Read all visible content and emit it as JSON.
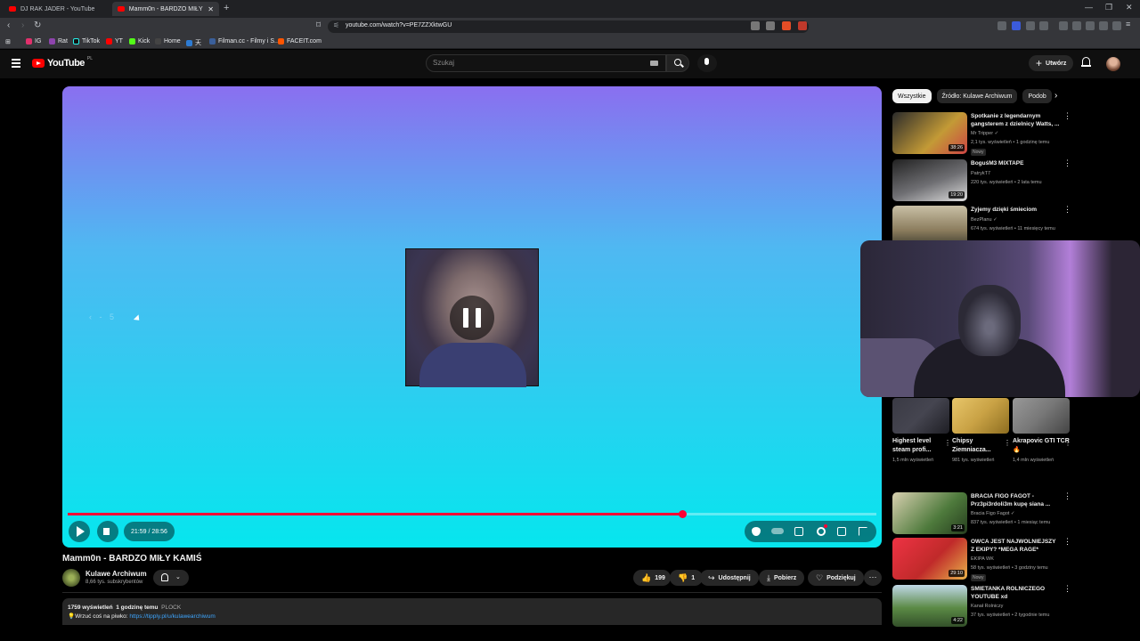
{
  "browser": {
    "tabs": [
      {
        "title": "DJ RAK JADER - YouTube",
        "active": false
      },
      {
        "title": "Mamm0n - BARDZO MIŁY KAMIŚ",
        "active": true
      }
    ],
    "url": "youtube.com/watch?v=PE7ZZXktwGU",
    "bookmarks": [
      {
        "label": "IG",
        "color": "#e1306c"
      },
      {
        "label": "Rat",
        "color": "#8e44ad"
      },
      {
        "label": "TikTok",
        "color": "#111111"
      },
      {
        "label": "YT",
        "color": "#ff0000"
      },
      {
        "label": "Kick",
        "color": "#53fc18"
      },
      {
        "label": "Home",
        "color": "#444444"
      },
      {
        "label": "天",
        "color": "#2d7bd3"
      },
      {
        "label": "Filman.cc - Filmy i S...",
        "color": "#3a5f9a"
      },
      {
        "label": "FACEIT.com",
        "color": "#ff5500"
      }
    ]
  },
  "youtube": {
    "logo": "YouTube",
    "region": "PL",
    "search_placeholder": "Szukaj",
    "create_label": "Utwórz"
  },
  "player": {
    "current_time": "21:59",
    "duration": "28:56",
    "time_display": "21:59 / 28:56",
    "progress_fraction": 0.76,
    "state": "paused",
    "seek_hint": "‹ - 5"
  },
  "video": {
    "title": "Mamm0n - BARDZO MIŁY KAMIŚ",
    "channel": "Kulawe Archiwum",
    "subscribers": "8,66 tys. subskrybentów",
    "likes": "199",
    "dislikes": "1",
    "share_label": "Udostępnij",
    "download_label": "Pobierz",
    "thanks_label": "Podziękuj",
    "views": "1759 wyświetleń",
    "posted": "1 godzinę temu",
    "location": "PLOCK",
    "desc_text": "💡Wrzuć coś na piwko: ",
    "desc_link": "https://tipply.pl/u/kulawearchiwum"
  },
  "sidebar": {
    "chips": [
      "Wszystkie",
      "Źródło: Kulawe Archiwum",
      "Podob"
    ],
    "top_recs": [
      {
        "title": "Spotkanie z legendarnym gangsterem z dzielnicy Watts, ...",
        "channel": "Mr Tripper ✓",
        "stats": "2,1 tys. wyświetleń • 1 godzinę temu",
        "badge": "Nowy",
        "duration": "38:26",
        "thumb": "#c39a36"
      },
      {
        "title": "BoguśM3 MIXTAPE",
        "channel": "PatrykT7",
        "stats": "220 tys. wyświetleń • 2 lata temu",
        "badge": "",
        "duration": "19:20",
        "thumb": "#6f6f73"
      },
      {
        "title": "Żyjemy dzięki śmieciom",
        "channel": "BezPlanu ✓",
        "stats": "674 tys. wyświetleń • 11 miesięcy temu",
        "badge": "",
        "duration": "",
        "thumb": "#8a7b5c"
      }
    ],
    "shorts": [
      {
        "title": "Highest level steam profi...",
        "views": "1,5 mln wyświetleń",
        "thumb": "#454550"
      },
      {
        "title": "Chipsy Ziemniacza...",
        "views": "981 tys. wyświetleń",
        "thumb": "#c9a245"
      },
      {
        "title": "Akrapovic GTI TCR 🔥",
        "views": "1,4 mln wyświetleń",
        "thumb": "#777777"
      }
    ],
    "bottom_recs": [
      {
        "title": "BRACIA FIGO FAGOT - Prz3pi3rdoli3m kupę siana ...",
        "channel": "Bracia Figo Fagot ✓",
        "stats": "837 tys. wyświetleń • 1 miesiąc temu",
        "badge": "",
        "duration": "3:21",
        "thumb": "#4e7a3c"
      },
      {
        "title": "OWCA JEST NAJWOLNIEJSZY Z EKIPY? *MEGA RAGE*",
        "channel": "EKIPA WK",
        "stats": "58 tys. wyświetleń • 3 godziny temu",
        "badge": "Nowy",
        "duration": "29:10",
        "thumb": "#c02a2a"
      },
      {
        "title": "ŚMIETANKA ROLNICZEGO YOUTUBE xd",
        "channel": "Kanał Rolniczy",
        "stats": "37 tys. wyświetleń • 2 tygodnie temu",
        "badge": "",
        "duration": "4:22",
        "thumb": "#5b8a45"
      }
    ]
  }
}
